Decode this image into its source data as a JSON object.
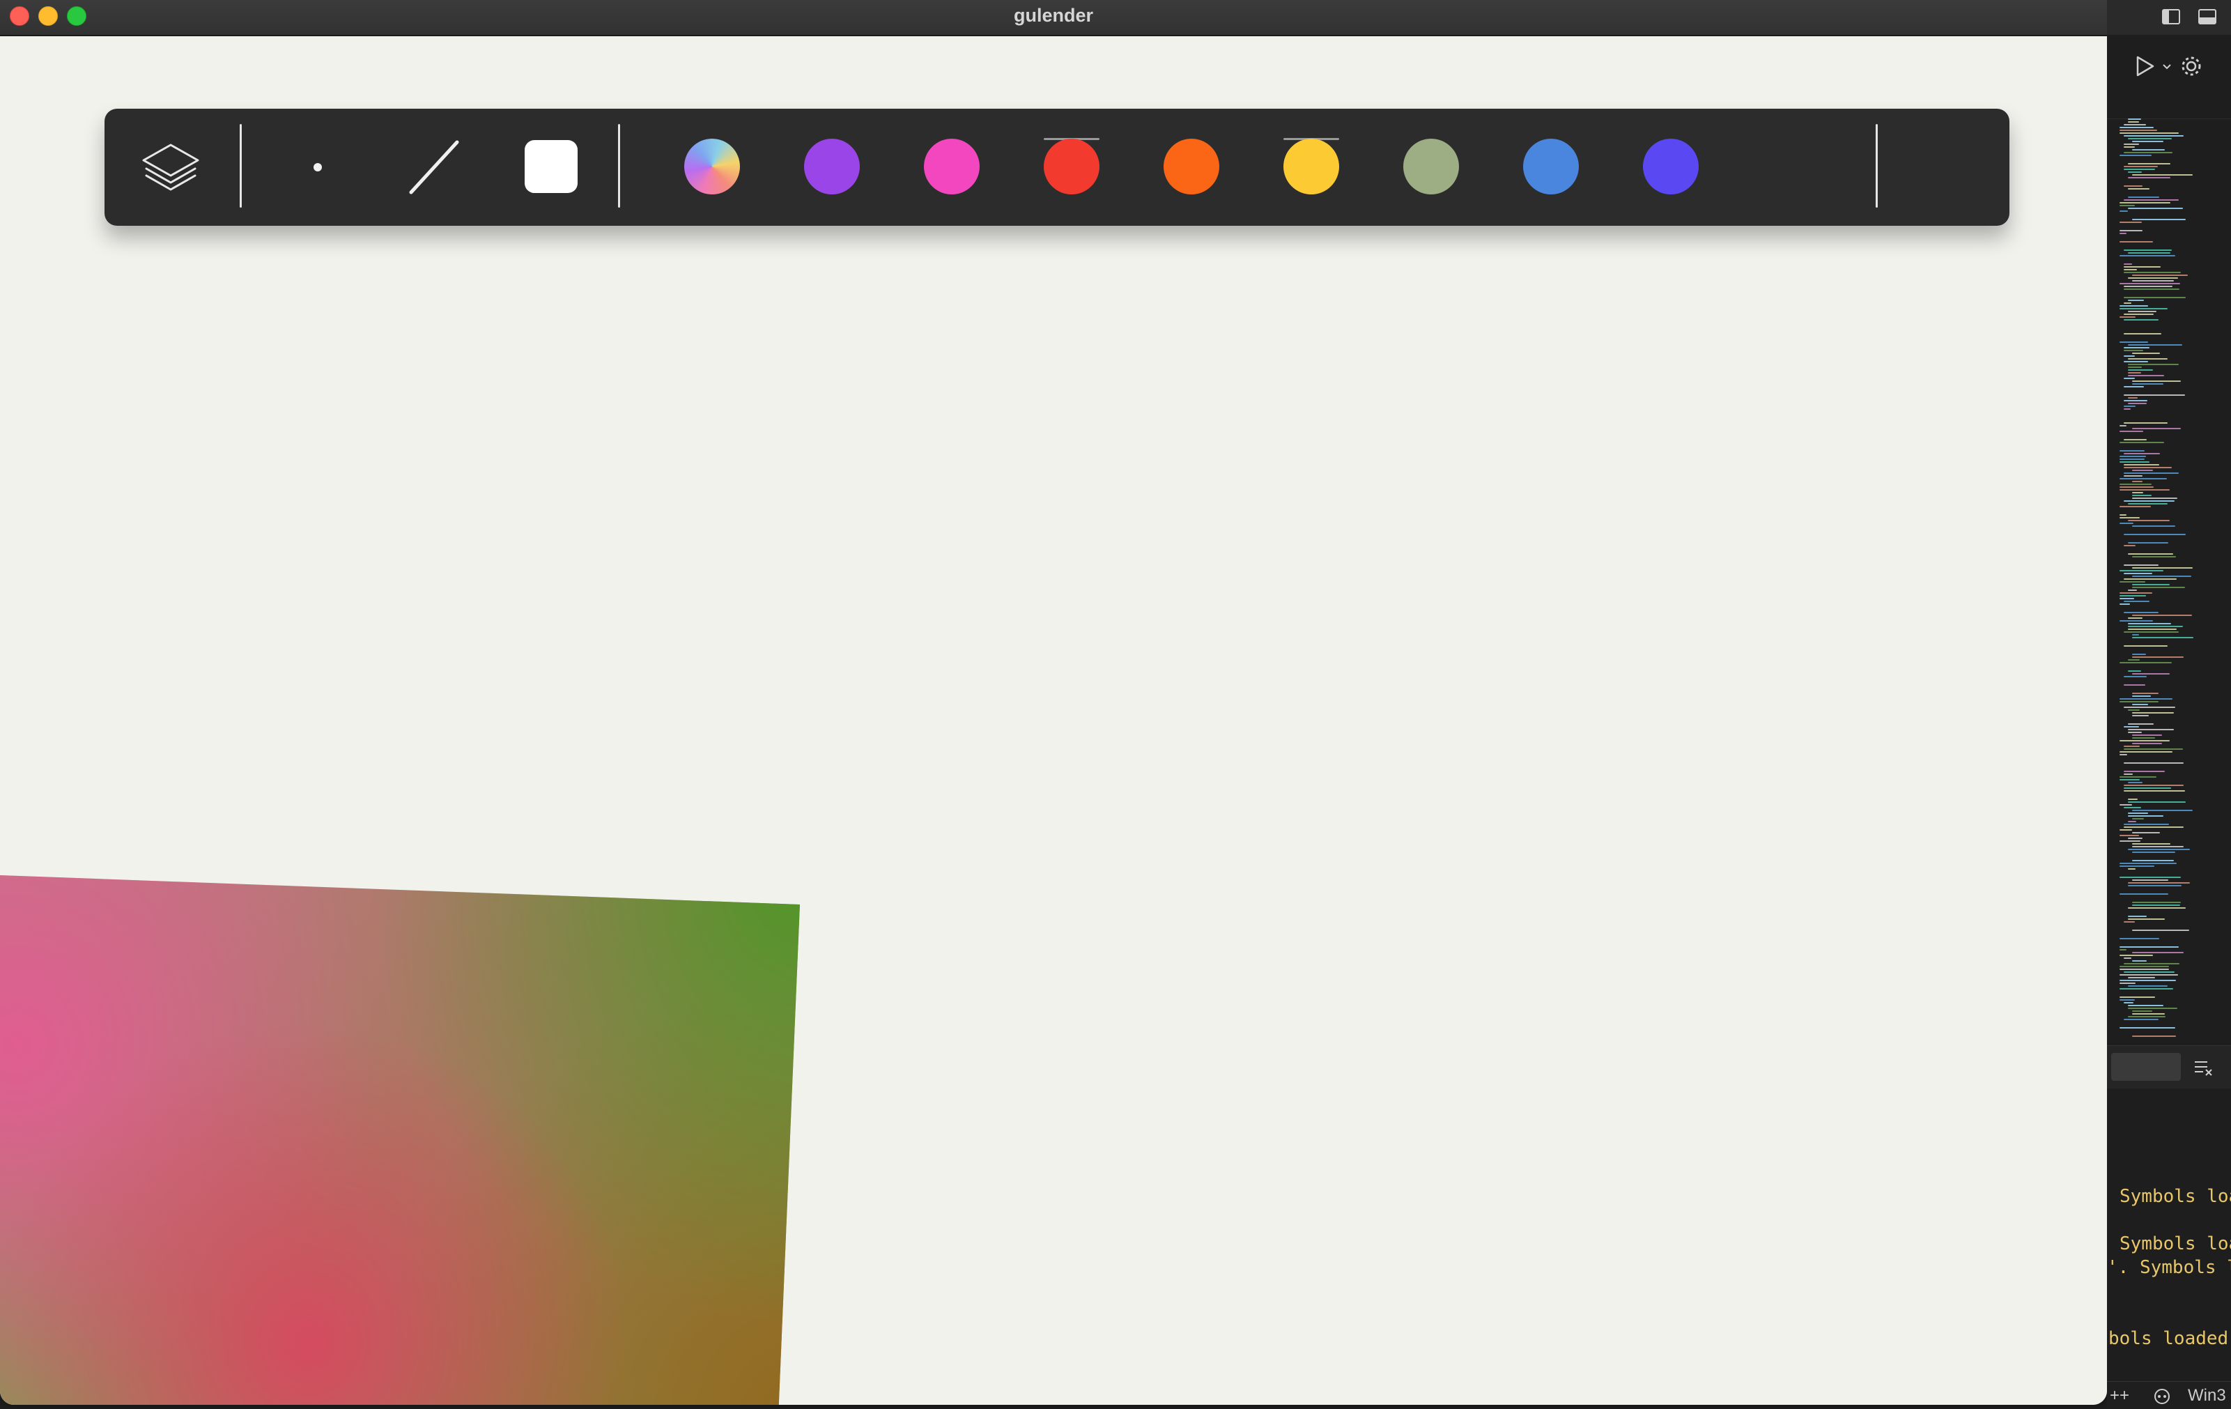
{
  "window": {
    "title": "gulender"
  },
  "toolbar": {
    "tools": [
      {
        "name": "layers",
        "icon": "layers-icon"
      },
      {
        "name": "point",
        "icon": "point-icon"
      },
      {
        "name": "line",
        "icon": "line-icon"
      },
      {
        "name": "rectangle",
        "icon": "square-icon"
      }
    ],
    "swatches": [
      {
        "name": "gradient",
        "color": "conic"
      },
      {
        "name": "purple",
        "color": "#9945e8"
      },
      {
        "name": "pink",
        "color": "#f347c0"
      },
      {
        "name": "red",
        "color": "#f23a2f",
        "marked": true
      },
      {
        "name": "orange",
        "color": "#fb6616"
      },
      {
        "name": "yellow",
        "color": "#fccb34",
        "marked": true
      },
      {
        "name": "sage",
        "color": "#9eae84"
      },
      {
        "name": "blue",
        "color": "#4a86de"
      },
      {
        "name": "indigo",
        "color": "#5a49f2"
      }
    ]
  },
  "editor": {
    "console_lines": [
      "Symbols loa",
      "Symbols loa",
      "'. Symbols l",
      "bols loaded."
    ],
    "status": {
      "left": "++",
      "right": "Win3"
    }
  }
}
